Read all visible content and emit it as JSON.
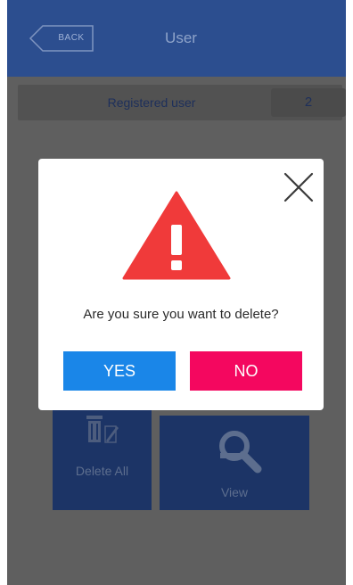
{
  "header": {
    "back_label": "BACK",
    "title": "User"
  },
  "registered": {
    "label": "Registered user",
    "count": "2"
  },
  "tiles": {
    "delete_all": "Delete All",
    "view": "View"
  },
  "dialog": {
    "message": "Are you sure you want to delete?",
    "yes_label": "YES",
    "no_label": "NO"
  },
  "icons": {
    "close": "close-icon",
    "warning": "warning-triangle-icon",
    "trash": "trash-icon",
    "search": "magnifier-icon"
  },
  "colors": {
    "header_bg": "#2c4e8f",
    "tile_bg": "#1c3466",
    "yes": "#1a86e8",
    "no": "#f4075f",
    "warning": "#f03a3a"
  }
}
